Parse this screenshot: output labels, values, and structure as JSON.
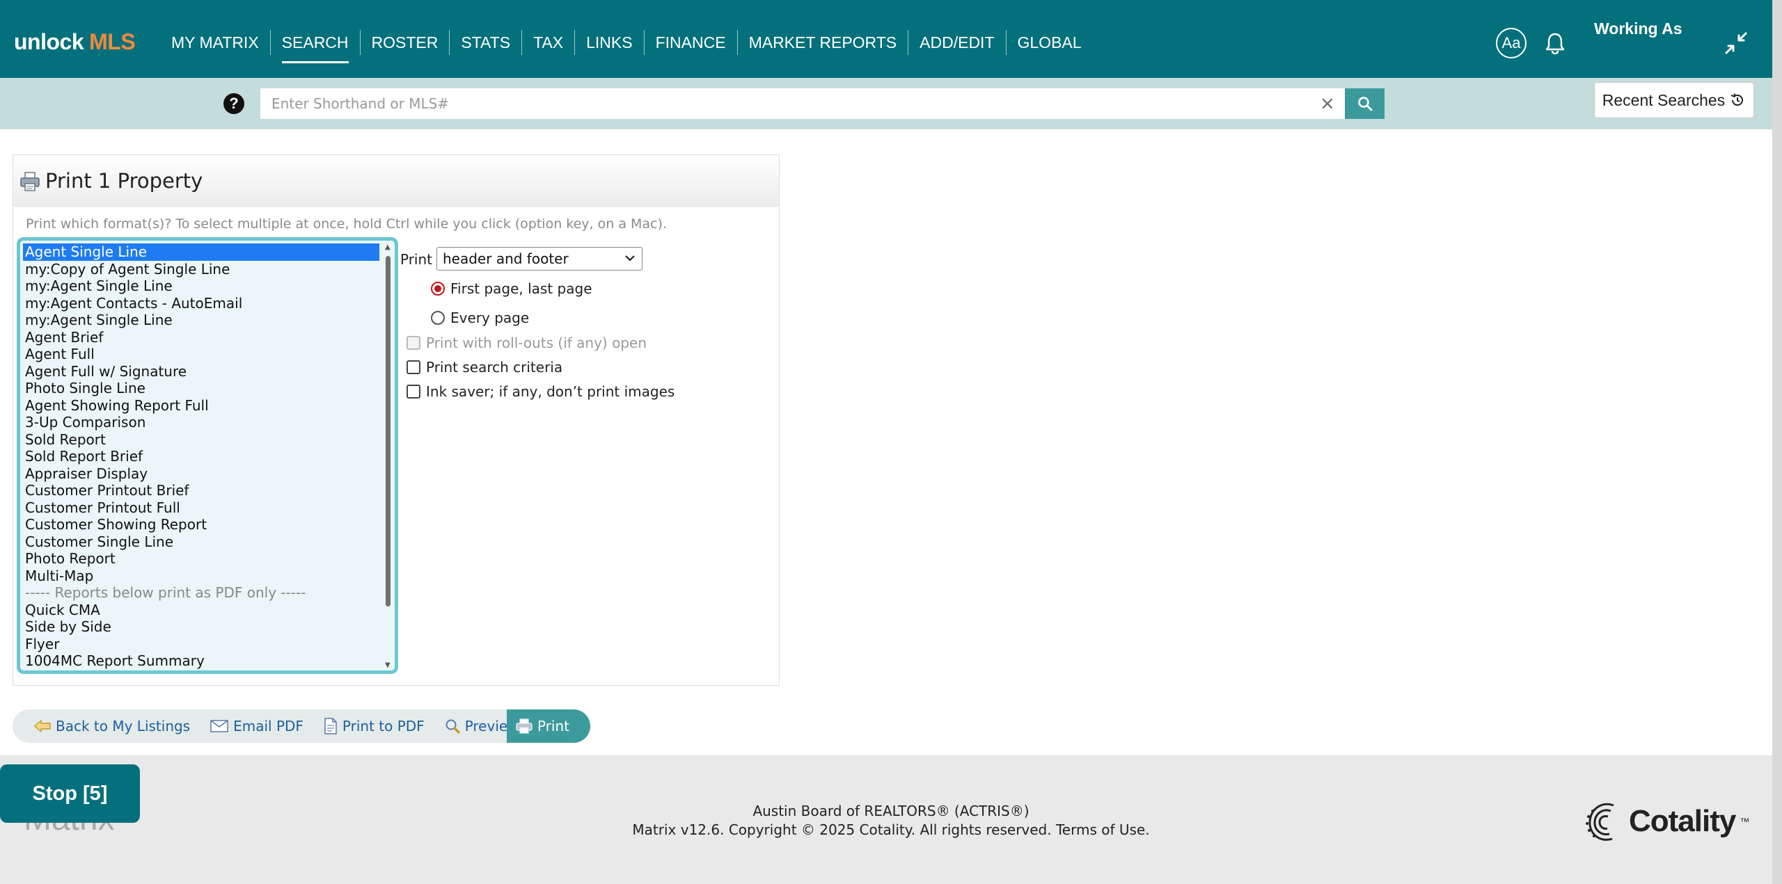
{
  "header": {
    "logo_part1": "unlock",
    "logo_part2": "MLS",
    "nav": [
      {
        "label": "MY MATRIX",
        "active": false
      },
      {
        "label": "SEARCH",
        "active": true
      },
      {
        "label": "ROSTER",
        "active": false
      },
      {
        "label": "STATS",
        "active": false
      },
      {
        "label": "TAX",
        "active": false
      },
      {
        "label": "LINKS",
        "active": false
      },
      {
        "label": "FINANCE",
        "active": false
      },
      {
        "label": "MARKET REPORTS",
        "active": false
      },
      {
        "label": "ADD/EDIT",
        "active": false
      },
      {
        "label": "GLOBAL",
        "active": false
      }
    ],
    "font_size_label": "Aa",
    "working_as": "Working As",
    "icons": [
      "font-size-icon",
      "bell-icon",
      "collapse-icon"
    ]
  },
  "search": {
    "placeholder": "Enter Shorthand or MLS#",
    "value": "",
    "clear": "×",
    "recent_label": "Recent Searches"
  },
  "panel": {
    "title": "Print 1 Property",
    "instructions": "Print which format(s)? To select multiple at once, hold Ctrl while you click (option key, on a Mac).",
    "formats": [
      {
        "label": "Agent Single Line",
        "selected": true
      },
      {
        "label": "my:Copy of Agent Single Line",
        "selected": false
      },
      {
        "label": "my:Agent Single Line",
        "selected": false
      },
      {
        "label": "my:Agent Contacts - AutoEmail",
        "selected": false
      },
      {
        "label": "my:Agent Single Line",
        "selected": false
      },
      {
        "label": "Agent Brief",
        "selected": false
      },
      {
        "label": "Agent Full",
        "selected": false
      },
      {
        "label": "Agent Full w/ Signature",
        "selected": false
      },
      {
        "label": "Photo Single Line",
        "selected": false
      },
      {
        "label": "Agent Showing Report Full",
        "selected": false
      },
      {
        "label": "3-Up Comparison",
        "selected": false
      },
      {
        "label": "Sold Report",
        "selected": false
      },
      {
        "label": "Sold Report Brief",
        "selected": false
      },
      {
        "label": "Appraiser Display",
        "selected": false
      },
      {
        "label": "Customer Printout Brief",
        "selected": false
      },
      {
        "label": "Customer Printout Full",
        "selected": false
      },
      {
        "label": "Customer Showing Report",
        "selected": false
      },
      {
        "label": "Customer Single Line",
        "selected": false
      },
      {
        "label": "Photo Report",
        "selected": false
      },
      {
        "label": "Multi-Map",
        "selected": false
      },
      {
        "label": "----- Reports below print as PDF only -----",
        "selected": false,
        "separator": true
      },
      {
        "label": "Quick CMA",
        "selected": false
      },
      {
        "label": "Side by Side",
        "selected": false
      },
      {
        "label": "Flyer",
        "selected": false
      },
      {
        "label": "1004MC Report Summary",
        "selected": false
      }
    ],
    "print_label": "Print",
    "print_select_value": "header and footer",
    "radio_first_last": "First page, last page",
    "radio_first_last_checked": true,
    "radio_every_page": "Every page",
    "radio_every_page_checked": false,
    "opt_rollouts": "Print with roll-outs (if any) open",
    "opt_rollouts_disabled": true,
    "opt_criteria": "Print search criteria",
    "opt_ink_saver": "Ink saver; if any, don’t print images"
  },
  "actions": {
    "back": "Back to My Listings",
    "email_pdf": "Email PDF",
    "print_pdf": "Print to PDF",
    "preview": "Preview",
    "print": "Print"
  },
  "footer": {
    "stop": "Stop [5]",
    "matrix_ghost": "Matrix",
    "line1": "Austin Board of REALTORS® (ACTRIS®)",
    "line2": "Matrix v12.6. Copyright © 2025 Cotality. All rights reserved.",
    "terms": "Terms of Use.",
    "cotality": "Cotality",
    "cotality_tm": "™"
  },
  "colors": {
    "header_bg": "#04707c",
    "logo_accent": "#f08a3c",
    "search_bg": "#c5dcdc",
    "accent_button": "#3d9a9c",
    "list_border": "#6cc7d2",
    "selected_option": "#1e7bf2",
    "radio_checked": "#c0171b",
    "link": "#1b5f9e"
  }
}
